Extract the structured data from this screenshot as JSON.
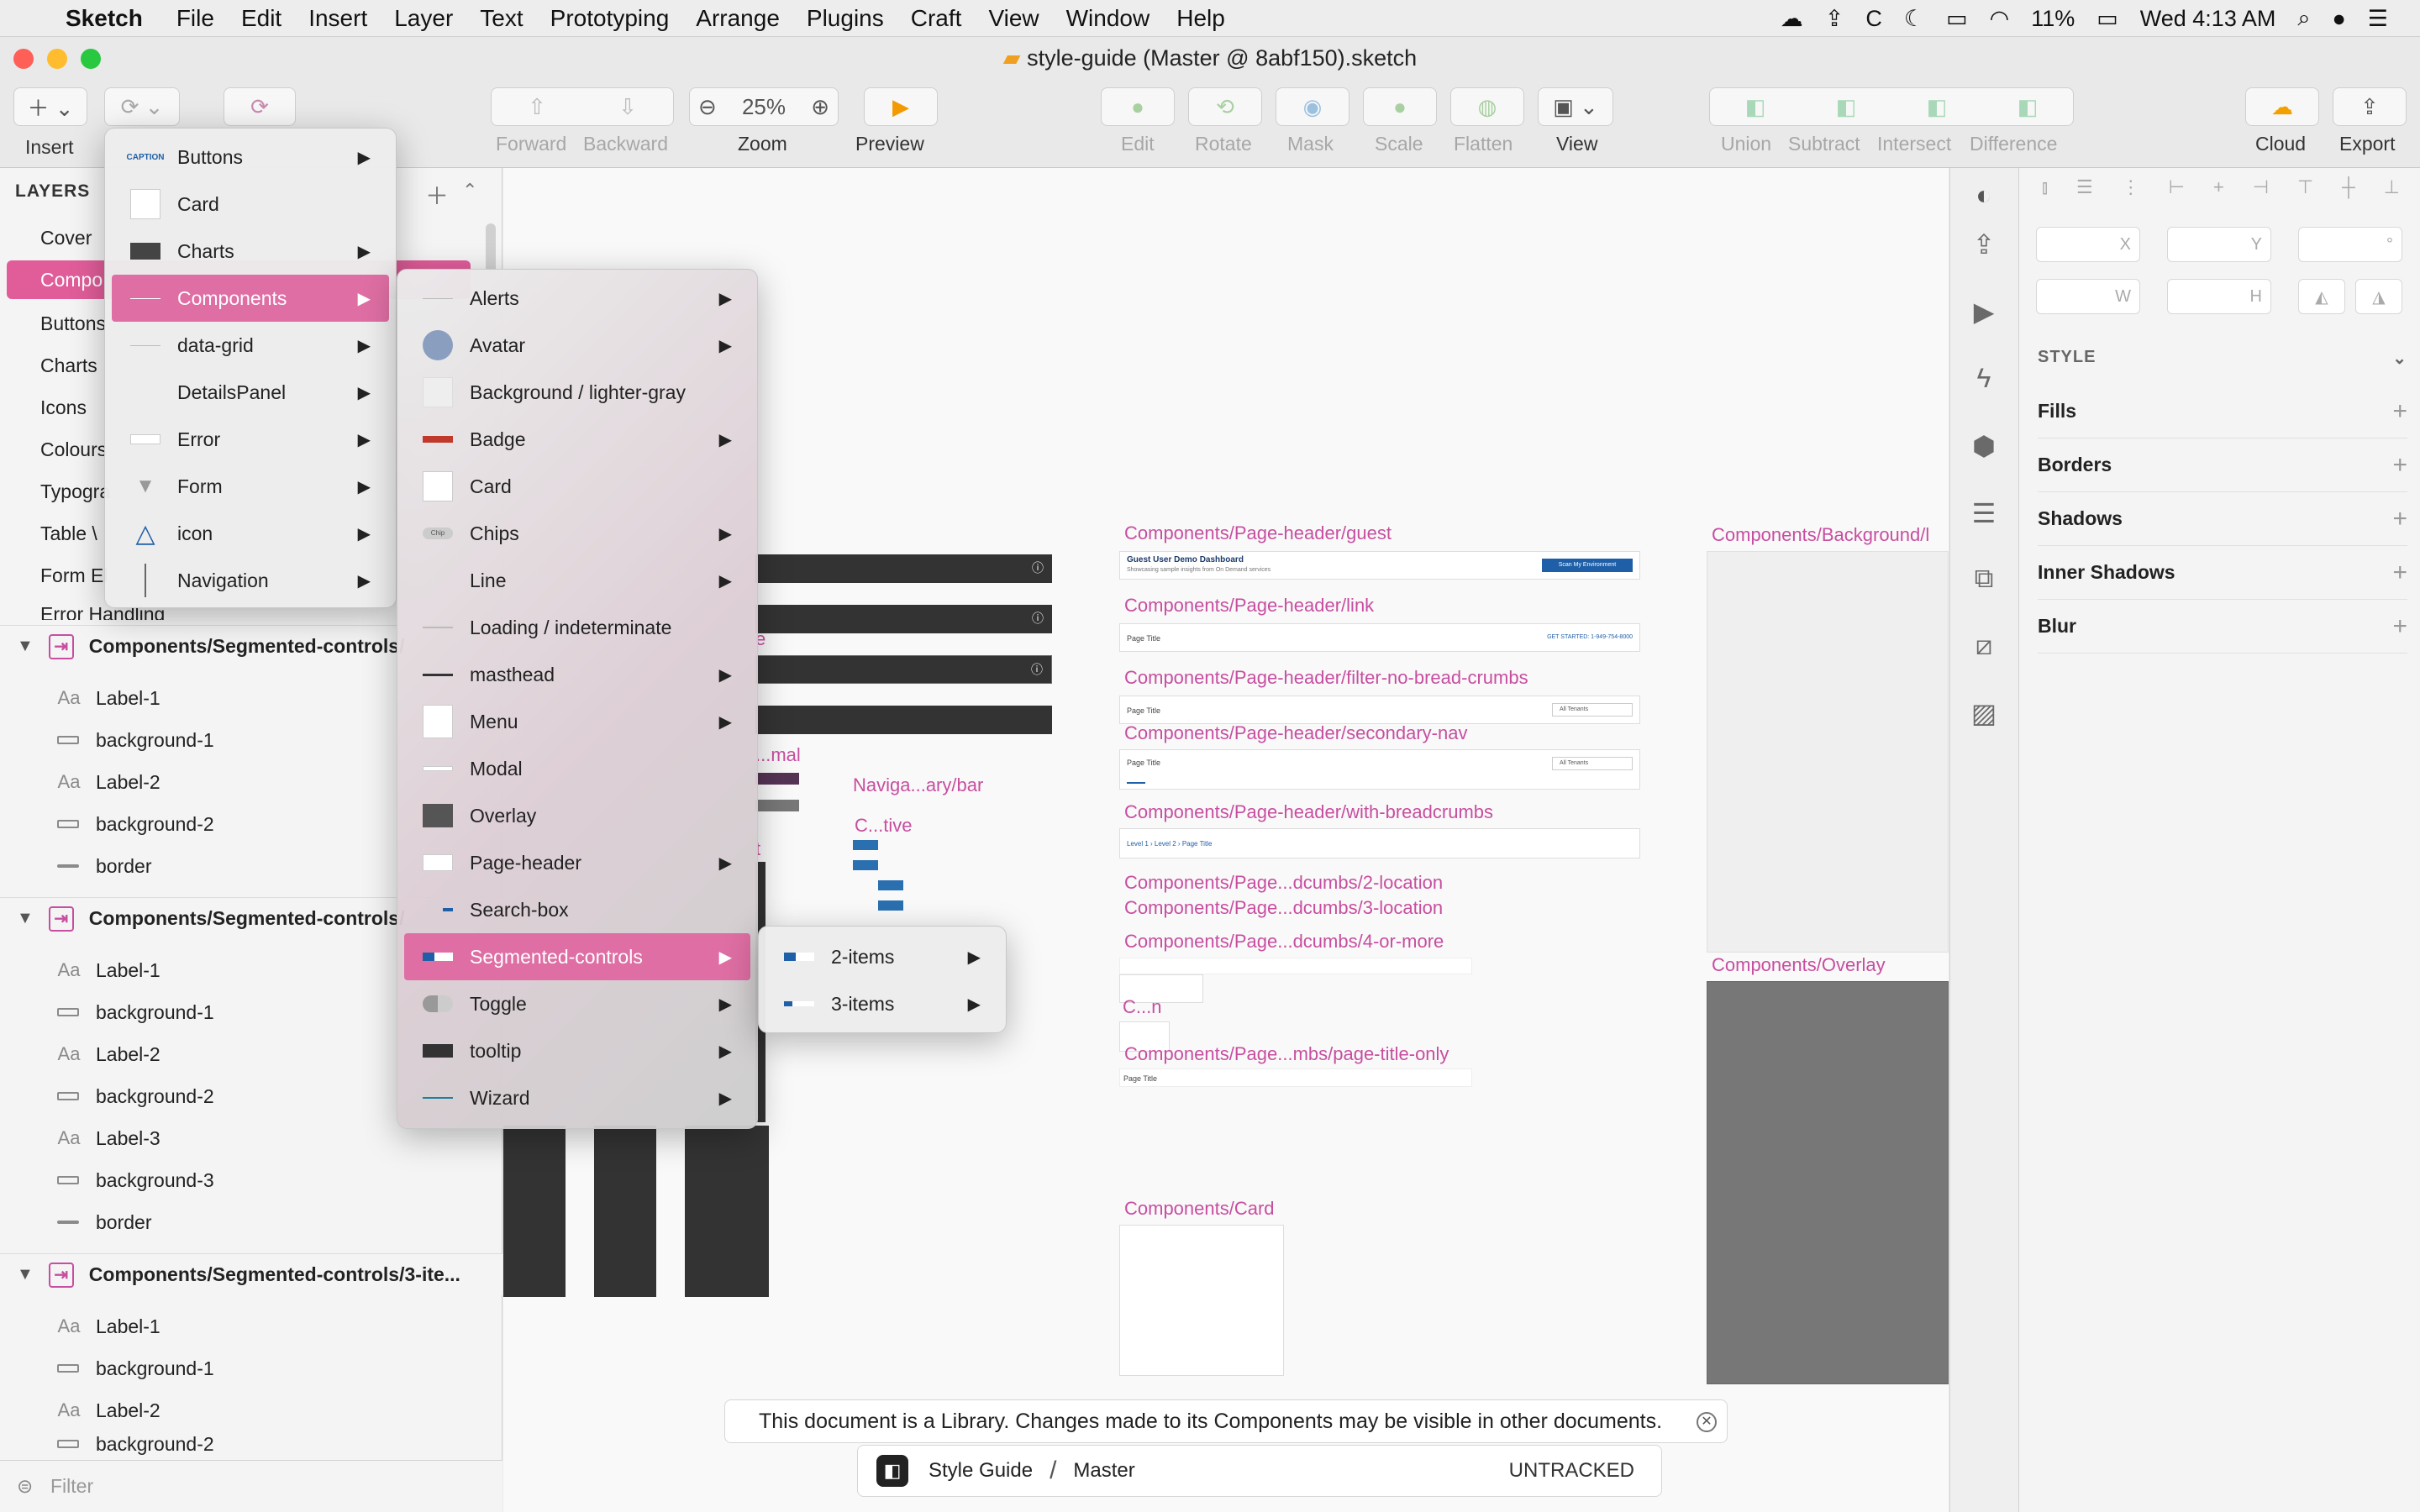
{
  "menubar": {
    "app": "Sketch",
    "items": [
      "File",
      "Edit",
      "Insert",
      "Layer",
      "Text",
      "Prototyping",
      "Arrange",
      "Plugins",
      "Craft",
      "View",
      "Window",
      "Help"
    ],
    "battery": "11%",
    "clock": "Wed 4:13 AM"
  },
  "window": {
    "title": "style-guide (Master @ 8abf150).sketch"
  },
  "toolbar": {
    "insert": "Insert",
    "forward": "Forward",
    "backward": "Backward",
    "zoom_value": "25%",
    "zoom": "Zoom",
    "preview": "Preview",
    "edit": "Edit",
    "rotate": "Rotate",
    "mask": "Mask",
    "scale": "Scale",
    "flatten": "Flatten",
    "view": "View",
    "union": "Union",
    "subtract": "Subtract",
    "intersect": "Intersect",
    "difference": "Difference",
    "cloud": "Cloud",
    "export": "Export"
  },
  "layers": {
    "heading": "LAYERS",
    "pages": [
      "Cover",
      "Compo",
      "Buttons",
      "Charts",
      "Icons",
      "Colours",
      "Typogra",
      "Table \\",
      "Form El",
      "Error Handling"
    ],
    "groups": [
      {
        "title": "Components/Segmented-controls/",
        "items": [
          "Label-1",
          "background-1",
          "Label-2",
          "background-2",
          "border"
        ]
      },
      {
        "title": "Components/Segmented-controls/",
        "items": [
          "Label-1",
          "background-1",
          "Label-2",
          "background-2",
          "Label-3",
          "background-3",
          "border"
        ]
      },
      {
        "title": "Components/Segmented-controls/3-ite...",
        "items": [
          "Label-1",
          "background-1",
          "Label-2",
          "background-2"
        ]
      }
    ],
    "filter": "Filter"
  },
  "canvas": {
    "labels": [
      "Components/Page-header/guest",
      "Components/Page-header/link",
      "Components/Page-header/filter-no-bread-crumbs",
      "Components/Page-header/secondary-nav",
      "Components/Page-header/with-breadcrumbs",
      "Components/Page...dcumbs/2-location",
      "Components/Page...dcumbs/3-location",
      "Components/Page...dcumbs/4-or-more",
      "Components/Page...mbs/page-title-only",
      "Components/Card",
      "Components/Background/l",
      "Components/Overlay"
    ],
    "small_labels": [
      "...mal",
      "Naviga...ary/bar",
      "C...tive",
      "C...n",
      "e",
      "t"
    ],
    "guest_title": "Guest User Demo Dashboard",
    "guest_sub": "Showcasing sample insights from On Demand services",
    "guest_btn": "Scan My Environment",
    "page_title": "Page Title",
    "link_text": "GET STARTED: 1-949-754-8000",
    "breadcrumb": "Level 1 › Level 2 › Page Title",
    "tenants": "All Tenants"
  },
  "menu1": {
    "items": [
      {
        "label": "Buttons",
        "arrow": true
      },
      {
        "label": "Card",
        "arrow": false
      },
      {
        "label": "Charts",
        "arrow": true
      },
      {
        "label": "Components",
        "arrow": true
      },
      {
        "label": "data-grid",
        "arrow": true
      },
      {
        "label": "DetailsPanel",
        "arrow": true
      },
      {
        "label": "Error",
        "arrow": true
      },
      {
        "label": "Form",
        "arrow": true
      },
      {
        "label": "icon",
        "arrow": true
      },
      {
        "label": "Navigation",
        "arrow": true
      }
    ],
    "caption_icon": "CAPTION"
  },
  "menu2": {
    "items": [
      {
        "label": "Alerts",
        "arrow": true
      },
      {
        "label": "Avatar",
        "arrow": true
      },
      {
        "label": "Background / lighter-gray",
        "arrow": false
      },
      {
        "label": "Badge",
        "arrow": true
      },
      {
        "label": "Card",
        "arrow": false
      },
      {
        "label": "Chips",
        "arrow": true
      },
      {
        "label": "Line",
        "arrow": true
      },
      {
        "label": "Loading / indeterminate",
        "arrow": false
      },
      {
        "label": "masthead",
        "arrow": true
      },
      {
        "label": "Menu",
        "arrow": true
      },
      {
        "label": "Modal",
        "arrow": false
      },
      {
        "label": "Overlay",
        "arrow": false
      },
      {
        "label": "Page-header",
        "arrow": true
      },
      {
        "label": "Search-box",
        "arrow": false
      },
      {
        "label": "Segmented-controls",
        "arrow": true
      },
      {
        "label": "Toggle",
        "arrow": true
      },
      {
        "label": "tooltip",
        "arrow": true
      },
      {
        "label": "Wizard",
        "arrow": true
      }
    ],
    "chip_icon": "Chip"
  },
  "menu3": {
    "items": [
      {
        "label": "2-items",
        "arrow": true
      },
      {
        "label": "3-items",
        "arrow": true
      }
    ]
  },
  "inspector": {
    "x": "X",
    "y": "Y",
    "deg": "°",
    "w": "W",
    "h": "H",
    "style": "STYLE",
    "sections": [
      "Fills",
      "Borders",
      "Shadows",
      "Inner Shadows",
      "Blur"
    ]
  },
  "notice": "This document is a Library. Changes made to its Components may be visible in other documents.",
  "vc": {
    "project": "Style Guide",
    "sep": "/",
    "branch": "Master",
    "status": "UNTRACKED"
  },
  "colors": {
    "accent": "#de6ea3",
    "artboard_label": "#c74ea0",
    "selection": "#e05d99"
  }
}
